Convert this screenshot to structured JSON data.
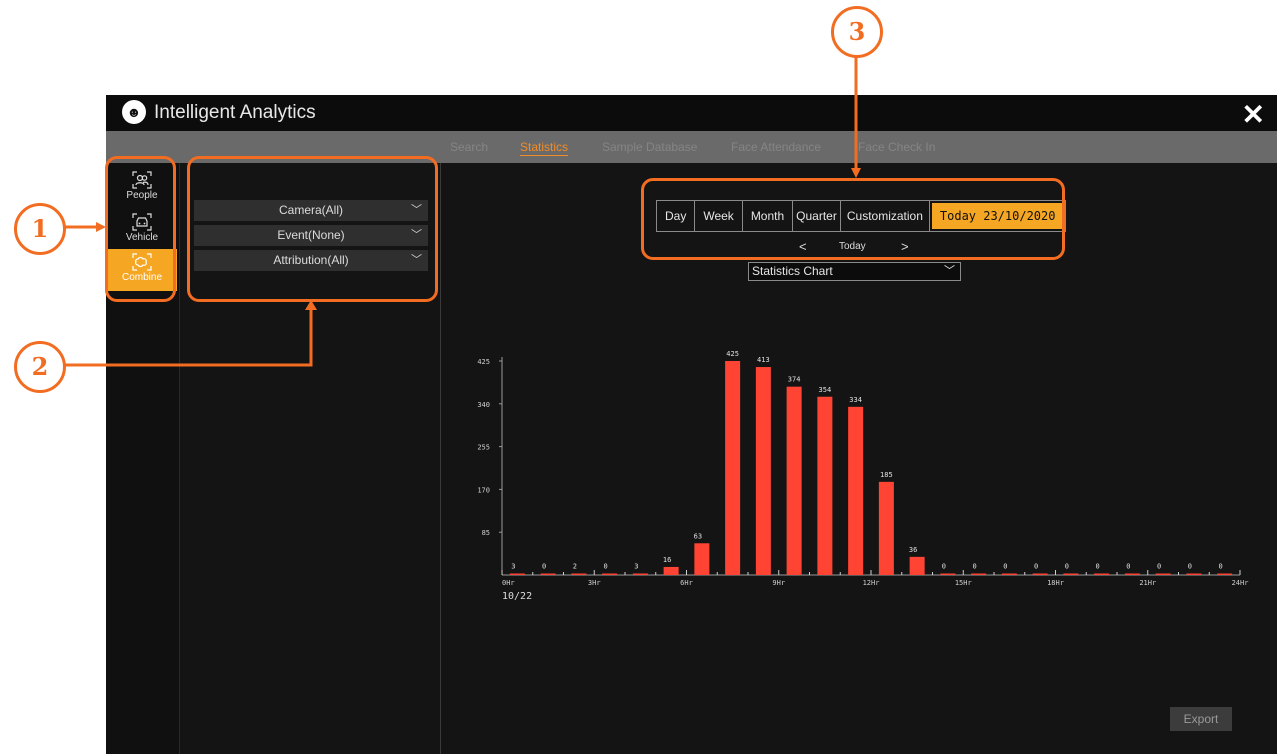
{
  "app": {
    "title": "Intelligent Analytics"
  },
  "tabs": [
    "Search",
    "Statistics",
    "Sample Database",
    "Face Attendance",
    "Face Check In"
  ],
  "active_tab": "Statistics",
  "sidebar": {
    "items": [
      {
        "label": "People",
        "icon": "people-icon"
      },
      {
        "label": "Vehicle",
        "icon": "vehicle-icon"
      },
      {
        "label": "Combine",
        "icon": "combine-icon"
      }
    ],
    "active": "Combine"
  },
  "filters": {
    "camera": "Camera(All)",
    "event": "Event(None)",
    "attribution": "Attribution(All)"
  },
  "periods": {
    "items": [
      "Day",
      "Week",
      "Month",
      "Quarter",
      "Customization"
    ],
    "selected": "Today 23/10/2020",
    "nav_label": "Today"
  },
  "chart_select": {
    "value": "Statistics Chart"
  },
  "export_label": "Export",
  "annotations": [
    "1",
    "2",
    "3"
  ],
  "colors": {
    "accent": "#f5a623",
    "bar": "#ff4433",
    "annotation": "#f26d21"
  },
  "chart_data": {
    "type": "bar",
    "x": [
      0,
      1,
      2,
      3,
      4,
      5,
      6,
      7,
      8,
      9,
      10,
      11,
      12,
      13,
      14,
      15,
      16,
      17,
      18,
      19,
      20,
      21,
      22,
      23
    ],
    "values": [
      3,
      0,
      2,
      0,
      3,
      16,
      63,
      425,
      413,
      374,
      354,
      334,
      185,
      36,
      0,
      0,
      0,
      0,
      0,
      0,
      0,
      0,
      0,
      0
    ],
    "value_labels": [
      "3",
      "0",
      "2",
      "0",
      "3",
      "16",
      "63",
      "425",
      "413",
      "374",
      "354",
      "334",
      "185",
      "36",
      "0",
      "0",
      "0",
      "0",
      "0",
      "0",
      "0",
      "0",
      "0",
      "0"
    ],
    "xticks": [
      "0Hr",
      "3Hr",
      "6Hr",
      "9Hr",
      "12Hr",
      "15Hr",
      "18Hr",
      "21Hr",
      "24Hr"
    ],
    "yticks": [
      "85",
      "170",
      "255",
      "340",
      "425"
    ],
    "ylim": [
      0,
      425
    ],
    "date_label": "10/22"
  }
}
